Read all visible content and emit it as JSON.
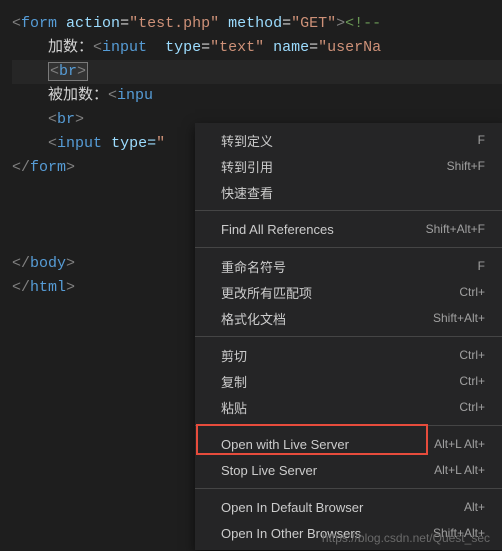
{
  "code": {
    "form_open_1": "<",
    "form_tag": "form",
    "action_attr": "action",
    "action_val": "\"test.php\"",
    "method_attr": "method",
    "method_val": "\"GET\"",
    "form_open_close": ">",
    "comment_start": "<!--",
    "line2_text": "加数：",
    "input_tag": "input",
    "type_attr": "type",
    "text_val": "\"text\"",
    "name_attr": "name",
    "userNa_val": "\"userNa",
    "br_tag": "br",
    "line4_text": "被加数：",
    "input_partial": "inpu",
    "type_eq_partial": "type=",
    "form_close_tag": "form",
    "body_close_tag": "body",
    "html_close_tag": "html"
  },
  "menu": {
    "items": [
      {
        "label": "转到定义",
        "shortcut": "F"
      },
      {
        "label": "转到引用",
        "shortcut": "Shift+F"
      },
      {
        "label": "快速查看",
        "shortcut": ""
      }
    ],
    "group2": [
      {
        "label": "Find All References",
        "shortcut": "Shift+Alt+F"
      }
    ],
    "group3": [
      {
        "label": "重命名符号",
        "shortcut": "F"
      },
      {
        "label": "更改所有匹配项",
        "shortcut": "Ctrl+"
      },
      {
        "label": "格式化文档",
        "shortcut": "Shift+Alt+"
      }
    ],
    "group4": [
      {
        "label": "剪切",
        "shortcut": "Ctrl+"
      },
      {
        "label": "复制",
        "shortcut": "Ctrl+"
      },
      {
        "label": "粘贴",
        "shortcut": "Ctrl+"
      }
    ],
    "group5": [
      {
        "label": "Open with Live Server",
        "shortcut": "Alt+L Alt+"
      },
      {
        "label": "Stop Live Server",
        "shortcut": "Alt+L Alt+"
      }
    ],
    "group6": [
      {
        "label": "Open In Default Browser",
        "shortcut": "Alt+"
      },
      {
        "label": "Open In Other Browsers",
        "shortcut": "Shift+Alt+"
      }
    ]
  },
  "watermark": "https://blog.csdn.net/Quest_sec"
}
